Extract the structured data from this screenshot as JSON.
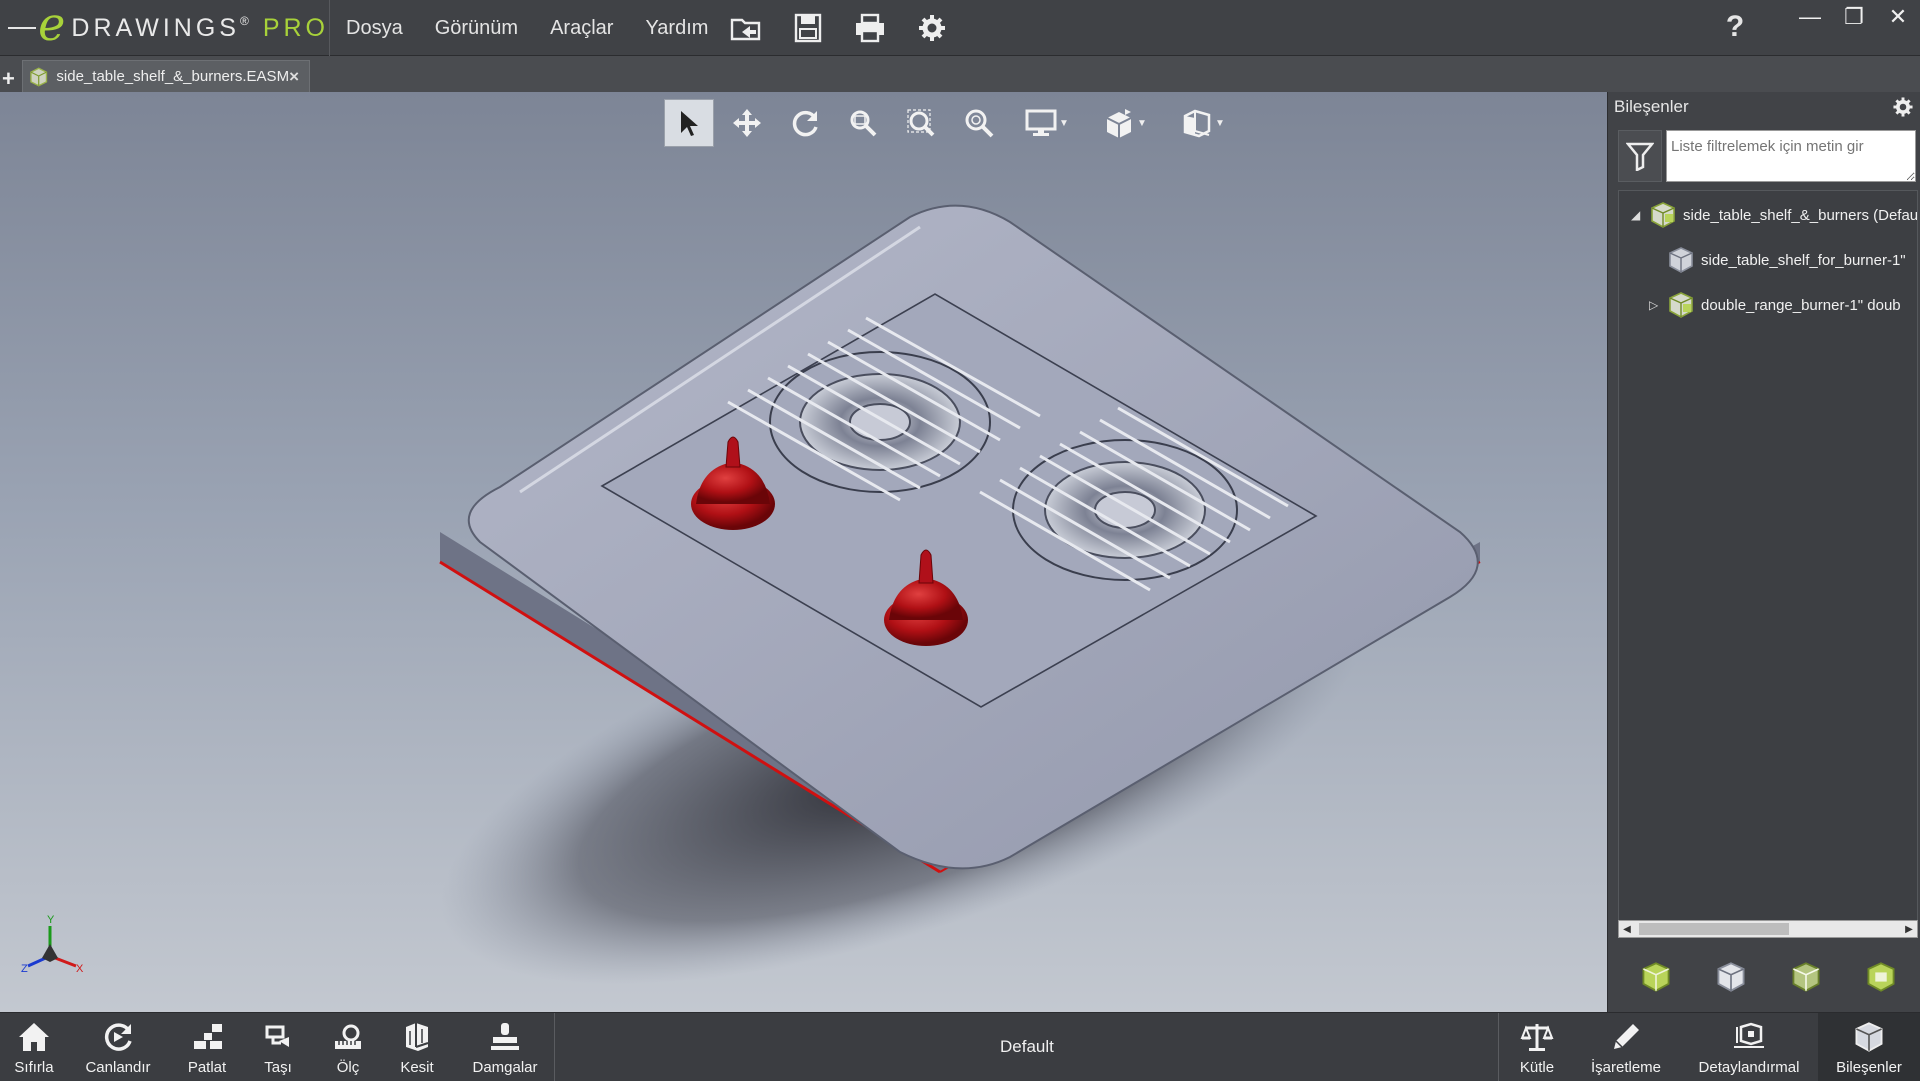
{
  "app": {
    "logo_e": "e",
    "logo_text": "DRAWINGS",
    "logo_reg": "®",
    "logo_pro": "PRO"
  },
  "menu": [
    "Dosya",
    "Görünüm",
    "Araçlar",
    "Yardım"
  ],
  "quick_tools": [
    "open-folder-icon",
    "save-icon",
    "print-icon",
    "settings-gear-icon"
  ],
  "window": {
    "help": "?",
    "minimize": "—",
    "restore": "❐",
    "close": "✕"
  },
  "tabs": {
    "add": "+",
    "doc_title": "side_table_shelf_&_burners.EASM",
    "close": "×"
  },
  "view_toolbar": [
    {
      "name": "select-icon"
    },
    {
      "name": "pan-icon"
    },
    {
      "name": "rotate-icon"
    },
    {
      "name": "zoom-to-fit-icon"
    },
    {
      "name": "zoom-to-area-icon"
    },
    {
      "name": "zoom-icon"
    },
    {
      "name": "display-style-icon",
      "dropdown": true
    },
    {
      "name": "view-orientation-icon",
      "dropdown": true
    },
    {
      "name": "section-view-icon",
      "dropdown": true
    }
  ],
  "triad": {
    "y": "Y",
    "z": "Z",
    "x": "X"
  },
  "components_panel": {
    "title": "Bileşenler",
    "filter_placeholder": "Liste filtrelemek için metin gir",
    "tree": [
      {
        "label": "side_table_shelf_&_burners (Default",
        "expanded": true,
        "level": 0
      },
      {
        "label": "side_table_shelf_for_burner-1\"",
        "level": 1
      },
      {
        "label": "double_range_burner-1\" doub",
        "expanded": false,
        "level": 1
      }
    ]
  },
  "bottom_left": [
    {
      "label": "Sıfırla",
      "icon": "home-icon"
    },
    {
      "label": "Canlandır",
      "icon": "animate-icon"
    },
    {
      "label": "Patlat",
      "icon": "explode-icon"
    },
    {
      "label": "Taşı",
      "icon": "move-icon"
    },
    {
      "label": "Ölç",
      "icon": "measure-icon"
    },
    {
      "label": "Kesit",
      "icon": "section-icon"
    },
    {
      "label": "Damgalar",
      "icon": "stamp-icon"
    }
  ],
  "configuration": "Default",
  "bottom_right": [
    {
      "label": "Kütle",
      "icon": "mass-scale-icon"
    },
    {
      "label": "İşaretleme",
      "icon": "markup-pen-icon"
    },
    {
      "label": "Detaylandırmal",
      "icon": "detailing-icon"
    },
    {
      "label": "Bileşenler",
      "icon": "components-icon"
    }
  ],
  "colors": {
    "accent_green": "#a8d23a",
    "knob_red": "#c0161a",
    "model_gray": "#9a9fb5"
  }
}
